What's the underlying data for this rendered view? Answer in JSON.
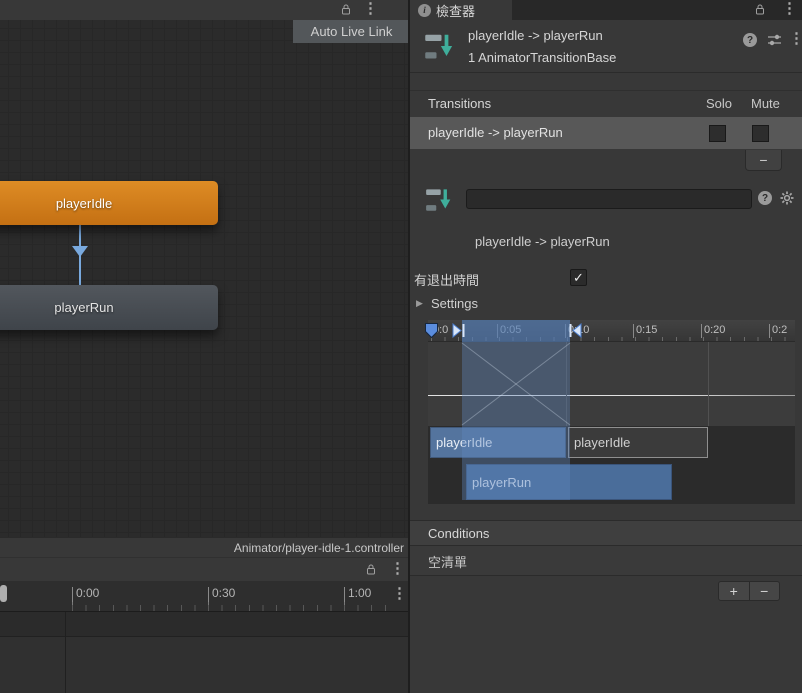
{
  "colors": {
    "state_orange": "#D7821F",
    "state_gray": "#4A4F55",
    "transition_blue": "#79A9DE",
    "timeline_blue": "#4C6F9A",
    "selection_gray": "#585858",
    "background": "#383838"
  },
  "icons": {
    "kebab": "⋮",
    "help": "?",
    "info": "i",
    "check": "✓",
    "foldout": "▶",
    "plus": "+",
    "minus": "−"
  },
  "graph": {
    "auto_live_link": "Auto Live Link",
    "status_path": "Animator/player-idle-1.controller",
    "states": {
      "idle": "playerIdle",
      "run": "playerRun"
    }
  },
  "anim_window": {
    "ticks": [
      "0:00",
      "0:30",
      "1:00"
    ]
  },
  "inspector": {
    "tab_label": "檢查器",
    "title": "playerIdle -> playerRun",
    "subtitle": "1 AnimatorTransitionBase",
    "transitions": {
      "header": "Transitions",
      "solo": "Solo",
      "mute": "Mute",
      "row_label": "playerIdle -> playerRun",
      "remove_label": "−"
    },
    "name_field_value": "",
    "transition_name": "playerIdle -> playerRun",
    "has_exit_time_label": "有退出時間",
    "settings_label": "Settings",
    "timeline": {
      "ticks": [
        "0:0",
        "0:05",
        "0:10",
        "0:15",
        "0:20",
        "0:2"
      ],
      "clip_idle_left": "playerIdle",
      "clip_idle_right": "playerIdle",
      "clip_run": "playerRun"
    },
    "conditions": {
      "header": "Conditions",
      "empty_label": "空清單",
      "add_label": "+",
      "remove_label": "−"
    }
  }
}
